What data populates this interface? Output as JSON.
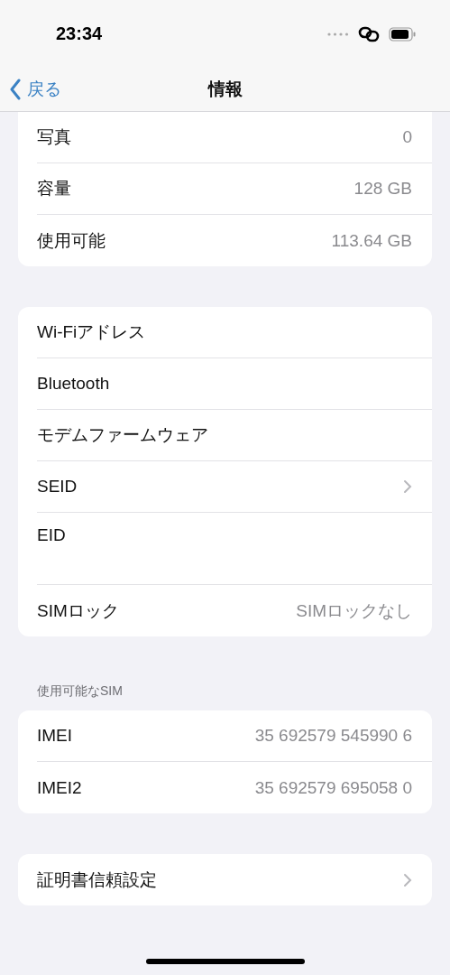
{
  "status_bar": {
    "time": "23:34"
  },
  "nav": {
    "back": "戻る",
    "title": "情報"
  },
  "groups": [
    {
      "rows": [
        {
          "kind": "value",
          "label": "写真",
          "value": "0"
        },
        {
          "kind": "value",
          "label": "容量",
          "value": "128 GB"
        },
        {
          "kind": "value",
          "label": "使用可能",
          "value": "113.64 GB"
        }
      ]
    },
    {
      "rows": [
        {
          "kind": "plain",
          "label": "Wi-Fiアドレス"
        },
        {
          "kind": "plain",
          "label": "Bluetooth"
        },
        {
          "kind": "plain",
          "label": "モデムファームウェア"
        },
        {
          "kind": "chevron",
          "label": "SEID"
        },
        {
          "kind": "tall",
          "label": "EID"
        },
        {
          "kind": "value",
          "label": "SIMロック",
          "value": "SIMロックなし"
        }
      ]
    },
    {
      "header": "使用可能なSIM",
      "rows": [
        {
          "kind": "value",
          "label": "IMEI",
          "value": "35 692579 545990 6"
        },
        {
          "kind": "value",
          "label": "IMEI2",
          "value": "35 692579 695058 0"
        }
      ]
    },
    {
      "rows": [
        {
          "kind": "chevron",
          "label": "証明書信頼設定"
        }
      ]
    }
  ]
}
